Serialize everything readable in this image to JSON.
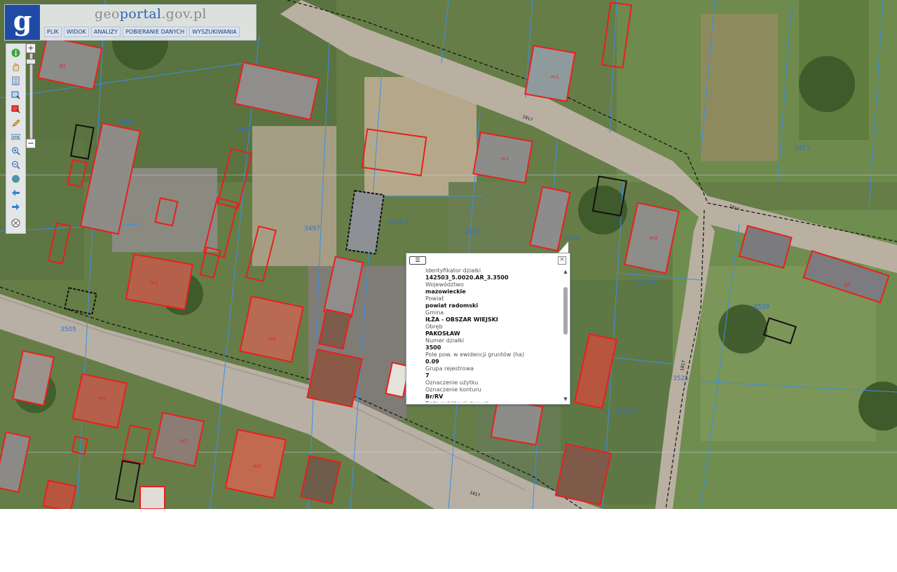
{
  "header": {
    "logo_letter": "g",
    "site_title_part1": "geo",
    "site_title_part2": "portal",
    "site_title_part3": ".gov.pl",
    "menu": [
      {
        "label": "PLIK"
      },
      {
        "label": "WIDOK"
      },
      {
        "label": "ANALIZY"
      },
      {
        "label": "POBIERANIE DANYCH"
      },
      {
        "label": "WYSZUKIWANIA"
      }
    ]
  },
  "toolbar": {
    "zoom_in_label": "+",
    "zoom_out_label": "−",
    "tools": [
      {
        "icon": "info-icon"
      },
      {
        "icon": "pan-hand-icon"
      },
      {
        "icon": "legend-icon"
      },
      {
        "icon": "select-area-icon"
      },
      {
        "icon": "clear-selection-icon"
      },
      {
        "icon": "pencil-measure-icon"
      },
      {
        "icon": "coordinates-icon"
      },
      {
        "icon": "zoom-in-icon"
      },
      {
        "icon": "zoom-out-icon"
      },
      {
        "icon": "full-extent-icon"
      },
      {
        "icon": "previous-extent-icon"
      },
      {
        "icon": "next-extent-icon"
      },
      {
        "icon": "clear-icon"
      }
    ]
  },
  "map": {
    "parcel_numbers": [
      "3495",
      "3496",
      "3497",
      "3498/2",
      "3499",
      "3500",
      "3504/1",
      "3504/2",
      "3505",
      "3529",
      "3411",
      "3525"
    ],
    "building_labels": [
      "g1",
      "m1",
      "m2",
      "m1",
      "g1",
      "m2",
      "m1",
      "m2",
      "m2",
      "m1"
    ],
    "road_labels": [
      "1817",
      "1817",
      "1817",
      "1817"
    ]
  },
  "popup": {
    "fields": [
      {
        "key": "Identyfikator działki",
        "value": "142503_5.0020.AR_3.3500"
      },
      {
        "key": "Województwo",
        "value": "mazowieckie"
      },
      {
        "key": "Powiat",
        "value": "powiat radomski"
      },
      {
        "key": "Gmina",
        "value": "IŁŻA - OBSZAR WIEJSKI"
      },
      {
        "key": "Obręb",
        "value": "PAKOSŁAW"
      },
      {
        "key": "Numer działki",
        "value": "3500"
      },
      {
        "key": "Pole pow. w ewidencji gruntów (ha)",
        "value": "0.09"
      },
      {
        "key": "Grupa rejestrowa",
        "value": "7"
      },
      {
        "key": "Oznaczenie użytku",
        "value": ""
      },
      {
        "key": "Oznaczenie konturu",
        "value": "Br/RV"
      },
      {
        "key": "Data publikacji danych",
        "value": ""
      }
    ]
  },
  "colors": {
    "parcel_line": "#3a8fe8",
    "building_outline": "#e8201e",
    "header_blue": "#1f4aa6"
  }
}
